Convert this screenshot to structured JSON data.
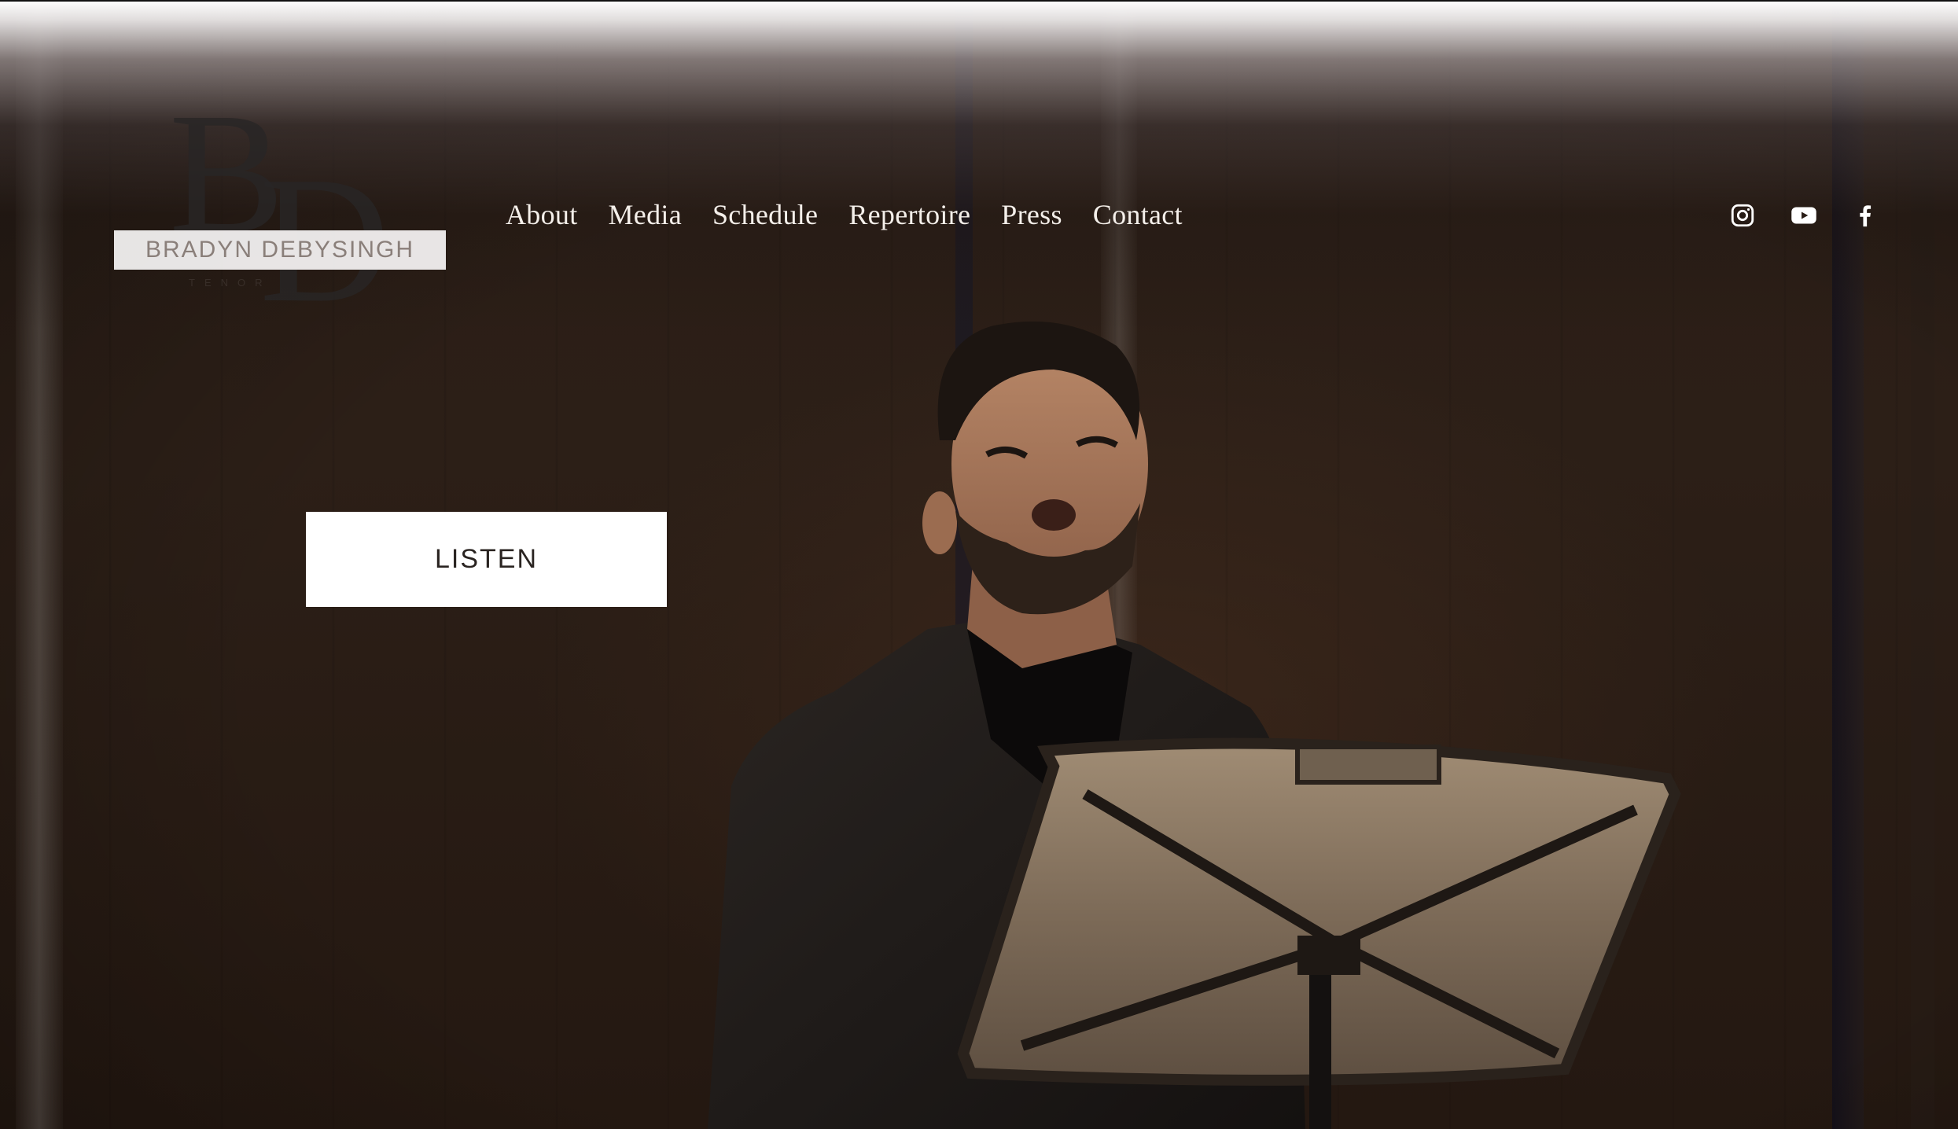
{
  "brand": {
    "monogram": "BD",
    "name": "BRADYN DEBYSINGH",
    "subtitle": "TENOR"
  },
  "nav": {
    "items": [
      {
        "label": "About"
      },
      {
        "label": "Media"
      },
      {
        "label": "Schedule"
      },
      {
        "label": "Repertoire"
      },
      {
        "label": "Press"
      },
      {
        "label": "Contact"
      }
    ]
  },
  "social": {
    "icons": [
      "instagram-icon",
      "youtube-icon",
      "facebook-icon"
    ]
  },
  "hero": {
    "cta_label": "LISTEN"
  },
  "colors": {
    "nav_text": "#f4efea",
    "button_bg": "#ffffff",
    "button_text": "#2a2421",
    "background": "#2a1d16"
  }
}
